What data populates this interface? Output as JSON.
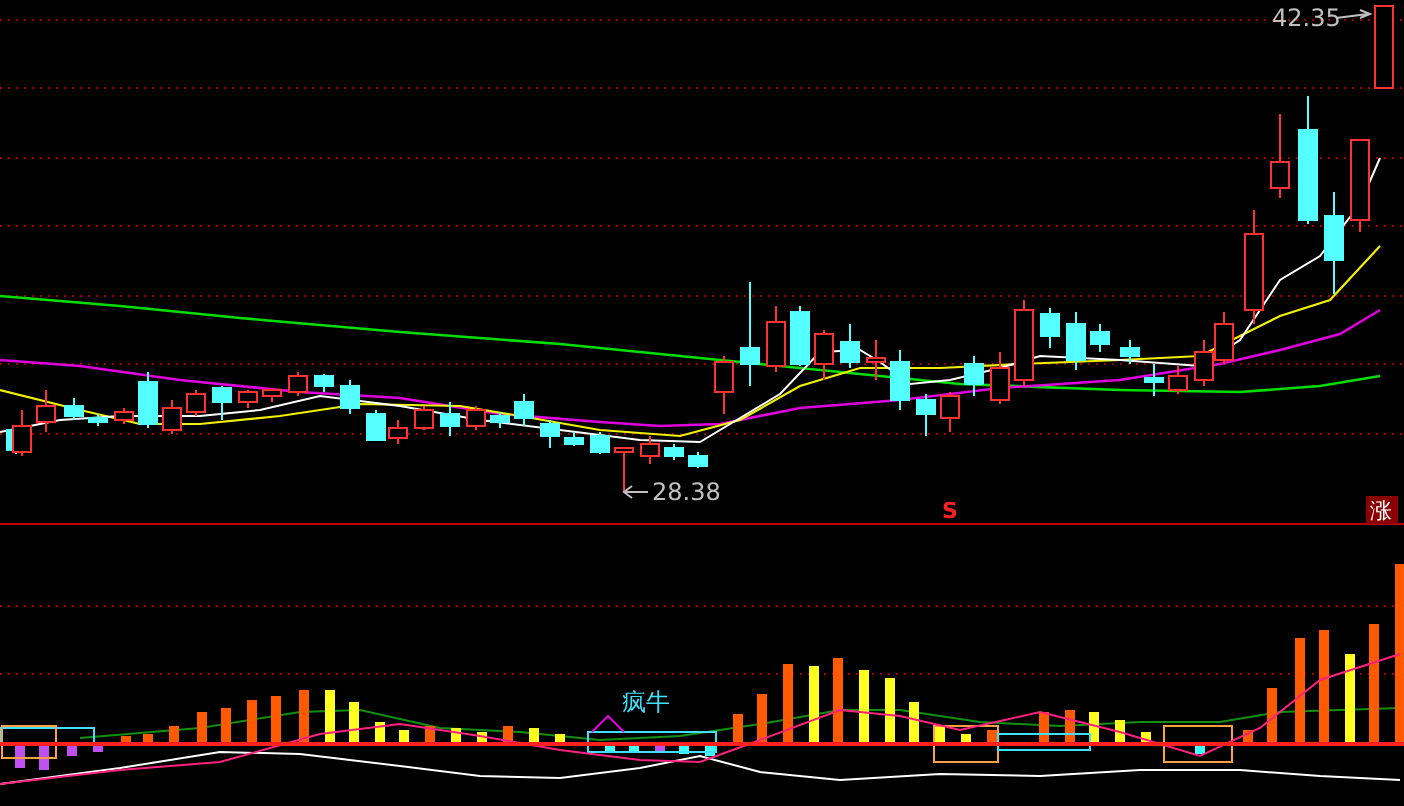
{
  "price_chart": {
    "high_price": "42.35",
    "low_price": "28.38",
    "signal_mark": "S",
    "badge": "涨"
  },
  "indicator_chart": {
    "label": "疯牛"
  }
}
